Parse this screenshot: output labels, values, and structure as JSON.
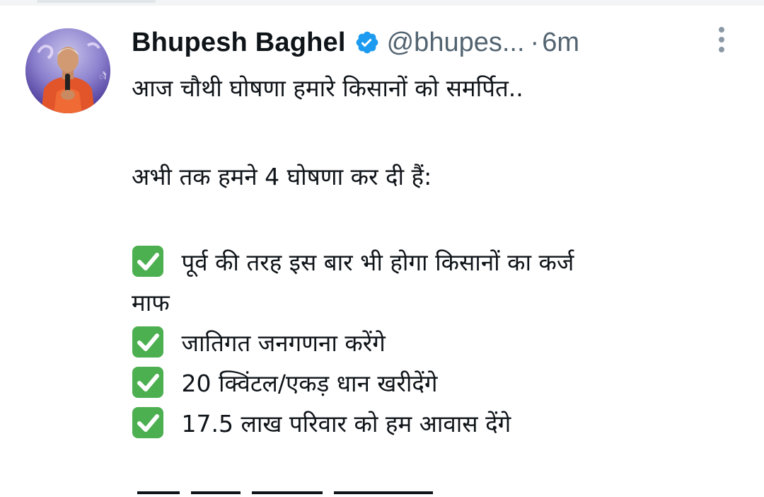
{
  "tweet": {
    "display_name": "Bhupesh Baghel",
    "handle": "@bhupes...",
    "separator": "·",
    "time": "6m",
    "lines": {
      "l1": "आज चौथी घोषणा हमारे किसानों को समर्पित..",
      "l2": "अभी तक हमने 4 घोषणा कर दी हैं:",
      "i1a": "पूर्व की तरह इस बार भी होगा किसानों का कर्ज",
      "i1b": "माफ",
      "i2": "जातिगत जनगणना करेंगे",
      "i3": "20 क्विंटल/एकड़ धान खरीदेंगे",
      "i4": "17.5 लाख परिवार को हम आवास देंगे"
    }
  },
  "colors": {
    "text": "#0f1419",
    "muted": "#536471",
    "verified": "#1d9bf0",
    "check_green": "#4caf50"
  },
  "icons": {
    "verified": "verified-badge-icon",
    "more": "more-vertical-icon",
    "check": "white-check-mark-emoji"
  }
}
